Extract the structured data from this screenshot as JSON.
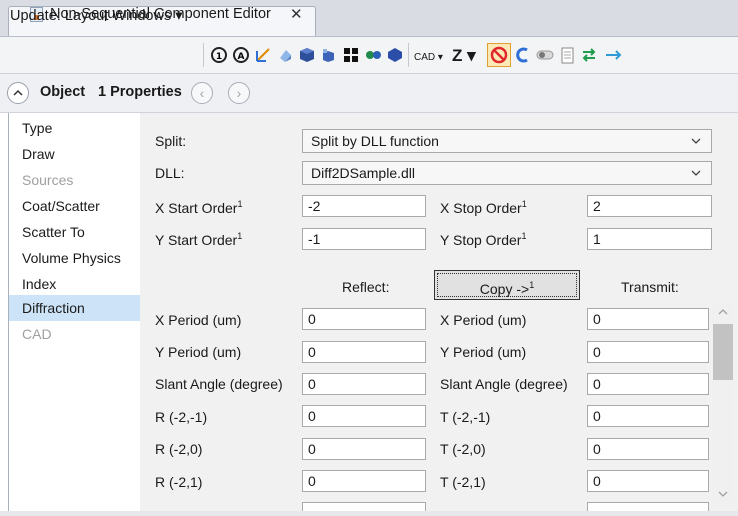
{
  "tab": {
    "title": "Non-Sequential Component Editor",
    "close": "✕"
  },
  "toolbar": {
    "update_label": "Update: Layout Windows ▾",
    "cad_label": "CAD ▾",
    "z_label": "Z ▾"
  },
  "object_header": {
    "title": "Object",
    "properties": "1 Properties",
    "prev": "‹",
    "next": "›",
    "collapse": "^"
  },
  "left_menu": [
    {
      "label": "Type",
      "state": "normal"
    },
    {
      "label": "Draw",
      "state": "normal"
    },
    {
      "label": "Sources",
      "state": "disabled"
    },
    {
      "label": "Coat/Scatter",
      "state": "normal"
    },
    {
      "label": "Scatter To",
      "state": "normal"
    },
    {
      "label": "Volume Physics",
      "state": "normal"
    },
    {
      "label": "Index",
      "state": "normal"
    },
    {
      "label": "Diffraction",
      "state": "selected"
    },
    {
      "label": "CAD",
      "state": "disabled"
    }
  ],
  "form": {
    "split_label": "Split:",
    "split_value": "Split by DLL function",
    "dll_label": "DLL:",
    "dll_value": "Diff2DSample.dll",
    "x_start_label": "X Start Order",
    "x_start_value": "-2",
    "x_stop_label": "X Stop Order",
    "x_stop_value": "2",
    "y_start_label": "Y Start Order",
    "y_start_value": "-1",
    "y_stop_label": "Y Stop Order",
    "y_stop_value": "1",
    "sup": "1",
    "reflect_label": "Reflect:",
    "copy_label": "Copy ->",
    "transmit_label": "Transmit:",
    "reflect_rows": [
      {
        "label": "X Period (um)",
        "value": "0"
      },
      {
        "label": "Y Period (um)",
        "value": "0"
      },
      {
        "label": "Slant Angle (degree)",
        "value": "0"
      },
      {
        "label": "R (-2,-1)",
        "value": "0"
      },
      {
        "label": "R (-2,0)",
        "value": "0"
      },
      {
        "label": "R (-2,1)",
        "value": "0"
      }
    ],
    "transmit_rows": [
      {
        "label": "X Period (um)",
        "value": "0"
      },
      {
        "label": "Y Period (um)",
        "value": "0"
      },
      {
        "label": "Slant Angle (degree)",
        "value": "0"
      },
      {
        "label": "T (-2,-1)",
        "value": "0"
      },
      {
        "label": "T (-2,0)",
        "value": "0"
      },
      {
        "label": "T (-2,1)",
        "value": "0"
      }
    ]
  },
  "colors": {
    "selected_bg": "#cde3f7",
    "accent_red": "#e0282b",
    "accent_blue": "#2f6fd6"
  }
}
